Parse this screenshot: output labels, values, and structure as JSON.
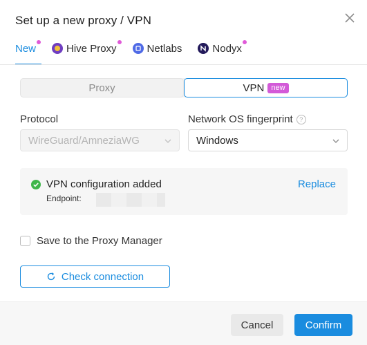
{
  "dialog": {
    "title": "Set up a new proxy / VPN"
  },
  "tabs": [
    {
      "label": "New",
      "icon": "",
      "active": true
    },
    {
      "label": "Hive Proxy",
      "icon": "hive-icon",
      "active": false
    },
    {
      "label": "Netlabs",
      "icon": "netlabs-icon",
      "active": false
    },
    {
      "label": "Nodyx",
      "icon": "nodyx-icon",
      "active": false
    }
  ],
  "mode": {
    "options": [
      "Proxy",
      "VPN"
    ],
    "selected": "VPN",
    "new_badge": "new"
  },
  "protocol": {
    "label": "Protocol",
    "value": "WireGuard/AmneziaWG"
  },
  "fingerprint": {
    "label": "Network OS fingerprint",
    "value": "Windows"
  },
  "vpn_status": {
    "title": "VPN configuration added",
    "endpoint_label": "Endpoint:",
    "replace_label": "Replace"
  },
  "save_option": {
    "label": "Save to the Proxy Manager",
    "checked": false
  },
  "check_connection": {
    "label": "Check connection"
  },
  "footer": {
    "cancel_label": "Cancel",
    "confirm_label": "Confirm"
  },
  "colors": {
    "accent": "#1a8cdf",
    "badge": "#d35ad8",
    "success": "#3fb64a"
  }
}
